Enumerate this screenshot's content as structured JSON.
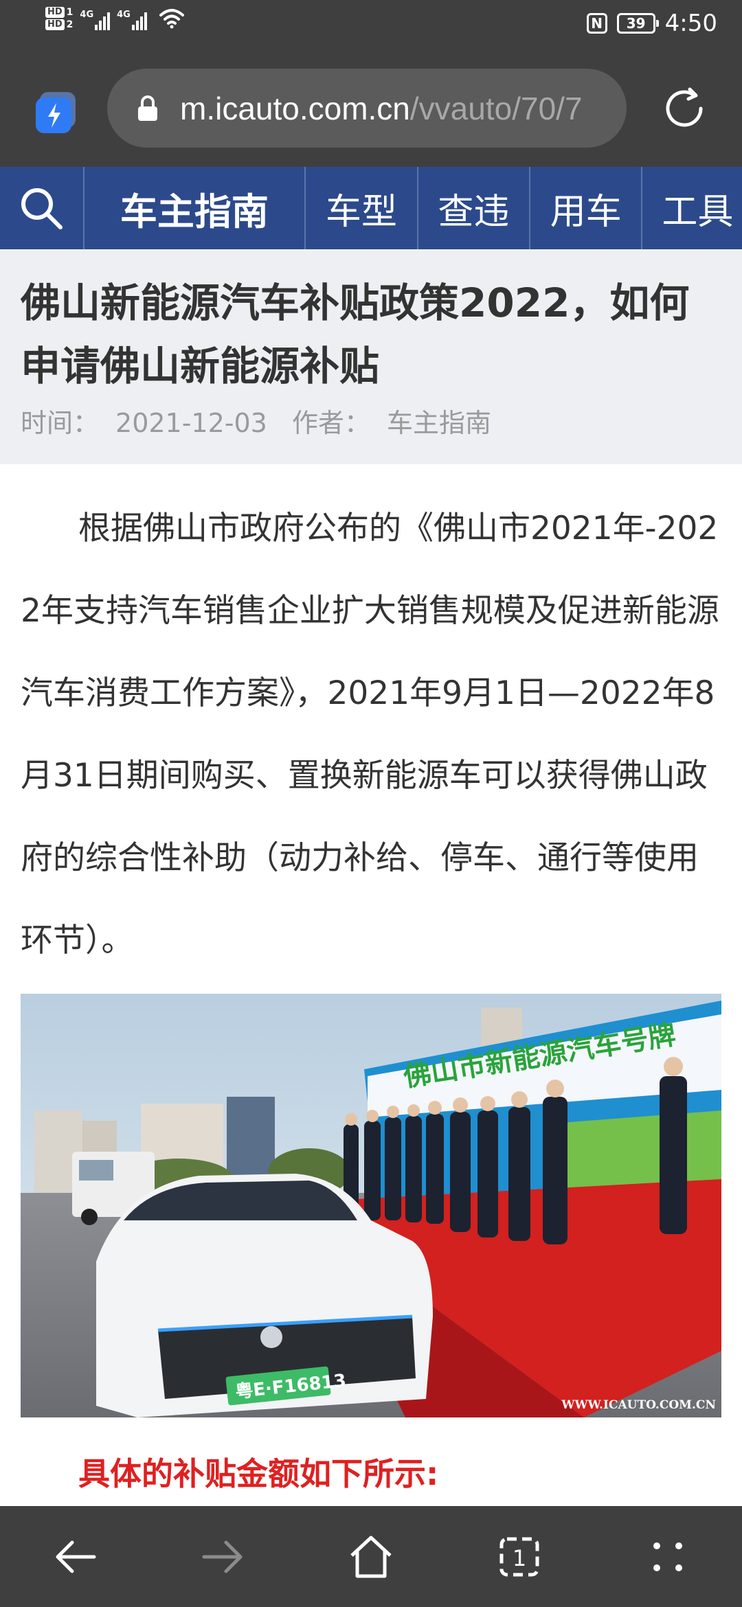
{
  "status_bar": {
    "hd1": "HD",
    "hd1_num": "1",
    "hd2": "HD",
    "hd2_num": "2",
    "net1": "4G",
    "net2": "4G",
    "battery": "39",
    "time": "4:50"
  },
  "browser": {
    "url_host": "m.icauto.com.cn",
    "url_path": "/vvauto/70/7"
  },
  "site_nav": {
    "brand": "车主指南",
    "items": [
      "车型",
      "查违",
      "用车",
      "工具"
    ]
  },
  "article": {
    "title": "佛山新能源汽车补贴政策2022，如何申请佛山新能源补贴",
    "time_label": "时间：",
    "time": "2021-12-03",
    "author_label": "作者：",
    "author": "车主指南",
    "paragraph": "根据佛山市政府公布的《佛山市2021年-2022年支持汽车销售企业扩大销售规模及促进新能源汽车消费工作方案》，2021年9月1日—2022年8月31日期间购买、置换新能源车可以获得佛山政府的综合性补助（动力补给、停车、通行等使用环节）。",
    "photo": {
      "banner": "佛山市新能源汽车号牌",
      "plate": "粤E·F16813",
      "watermark": "WWW.ICAUTO.COM.CN"
    },
    "subheading": "具体的补贴金额如下所示:"
  },
  "colors": {
    "chrome": "#3f3f3f",
    "nav_blue": "#2c4a8b",
    "accent_red": "#e02020",
    "header_bg": "#eeeff3"
  },
  "icons": {
    "browser_logo": "lightning-icon",
    "lock": "lock-icon",
    "reload": "reload-icon",
    "search": "search-icon",
    "back": "back-arrow-icon",
    "forward": "forward-arrow-icon",
    "home": "home-icon",
    "tabs": "tabs-icon",
    "menu": "menu-dots-icon"
  },
  "bottom_nav": {
    "tab_count": "1"
  }
}
